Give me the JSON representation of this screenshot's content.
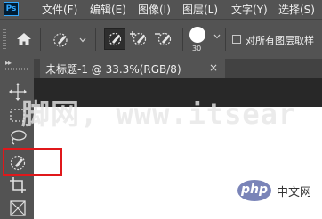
{
  "app": {
    "logo_text": "Ps"
  },
  "menu": [
    {
      "label": "文件(F)"
    },
    {
      "label": "编辑(E)"
    },
    {
      "label": "图像(I)"
    },
    {
      "label": "图层(L)"
    },
    {
      "label": "文字(Y)"
    },
    {
      "label": "选择(S)"
    }
  ],
  "options_bar": {
    "brush_size": "30",
    "sample_all_layers_label": "对所有图层取样",
    "sample_all_layers_checked": false
  },
  "document": {
    "tab_title": "未标题-1 @ 33.3%(RGB/8)",
    "close_symbol": "×"
  },
  "watermark_text": "脚网, www.itsear",
  "site_badge": {
    "logo": "php",
    "text": "中文网"
  },
  "colors": {
    "ui_dark": "#535353",
    "highlight": "#e0181b"
  }
}
